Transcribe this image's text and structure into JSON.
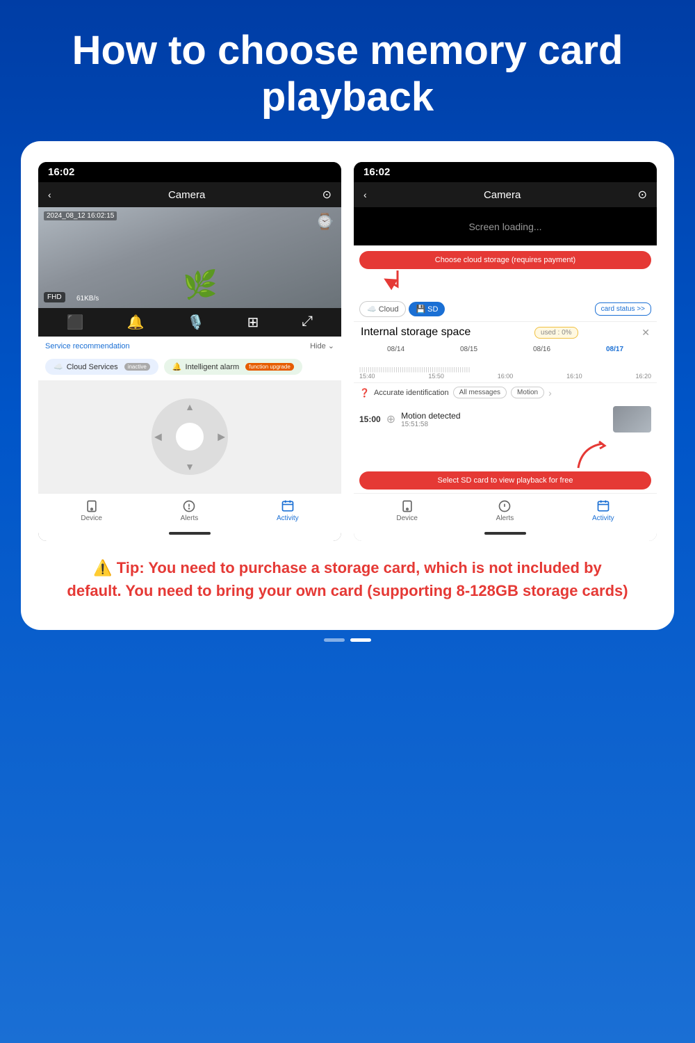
{
  "header": {
    "title": "How to choose memory card playback"
  },
  "left_phone": {
    "time": "16:02",
    "camera_label": "Camera",
    "timestamp": "2024_08_12 16:02:15",
    "fhd": "FHD",
    "speed": "61KB/s",
    "service_recommendation": "Service recommendation",
    "hide": "Hide ⌄",
    "cloud_services": "Cloud Services",
    "inactive_badge": "inactive",
    "intelligent_alarm": "Intelligent alarm",
    "function_upgrade_badge": "function upgrade",
    "bottom_nav": {
      "device": "Device",
      "alerts": "Alerts",
      "activity": "Activity"
    }
  },
  "right_phone": {
    "time": "16:02",
    "camera_label": "Camera",
    "screen_loading": "Screen loading...",
    "cloud_callout": "Choose cloud storage (requires payment)",
    "tab_cloud": "Cloud",
    "tab_sd": "SD",
    "card_status": "card status >>",
    "storage_title": "Internal storage space",
    "used_label": "used : 0%",
    "dates": [
      "08/14",
      "08/15",
      "08/16",
      "08/17"
    ],
    "times": [
      "15:40",
      "15:50",
      "16:00",
      "16:10",
      "16:20"
    ],
    "accurate_identification": "Accurate identification",
    "all_messages": "All messages",
    "motion": "Motion",
    "event_time": "15:00",
    "event_title": "Motion detected",
    "event_sub": "15:51:58",
    "sd_callout": "Select SD card to view playback for free",
    "bottom_nav": {
      "device": "Device",
      "alerts": "Alerts",
      "activity": "Activity"
    }
  },
  "tip": {
    "icon": "⚠️",
    "text": "Tip: You need to purchase a storage card, which is not included by default. You need to bring your own card (supporting 8-128GB storage cards)"
  },
  "page_indicator": {
    "dots": [
      false,
      true
    ]
  }
}
